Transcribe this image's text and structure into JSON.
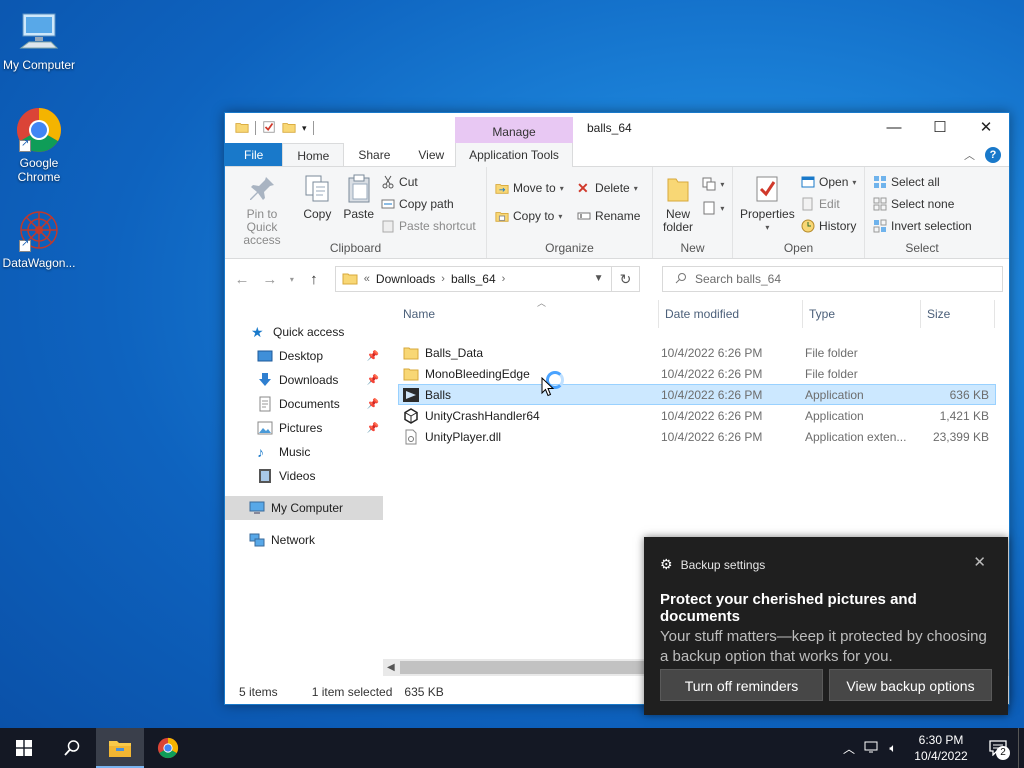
{
  "desktop": {
    "icons": [
      {
        "label": "My Computer"
      },
      {
        "label": "Google Chrome"
      },
      {
        "label": "DataWagon..."
      }
    ]
  },
  "window": {
    "title": "balls_64",
    "context_tab_group": "Manage",
    "tabs": {
      "file": "File",
      "home": "Home",
      "share": "Share",
      "view": "View",
      "app_tools": "Application Tools"
    },
    "ribbon": {
      "clipboard": {
        "label": "Clipboard",
        "pin": "Pin to Quick access",
        "copy": "Copy",
        "paste": "Paste",
        "cut": "Cut",
        "copy_path": "Copy path",
        "paste_shortcut": "Paste shortcut"
      },
      "organize": {
        "label": "Organize",
        "move_to": "Move to",
        "copy_to": "Copy to",
        "delete": "Delete",
        "rename": "Rename"
      },
      "new": {
        "label": "New",
        "new_folder": "New folder"
      },
      "open": {
        "label": "Open",
        "properties": "Properties",
        "open": "Open",
        "edit": "Edit",
        "history": "History"
      },
      "select": {
        "label": "Select",
        "select_all": "Select all",
        "select_none": "Select none",
        "invert": "Invert selection"
      }
    },
    "address": {
      "crumbs": [
        "Downloads",
        "balls_64"
      ],
      "search_placeholder": "Search balls_64"
    },
    "nav_pane": {
      "quick_access": "Quick access",
      "items": [
        "Desktop",
        "Downloads",
        "Documents",
        "Pictures",
        "Music",
        "Videos"
      ],
      "my_computer": "My Computer",
      "network": "Network"
    },
    "columns": {
      "name": "Name",
      "date": "Date modified",
      "type": "Type",
      "size": "Size"
    },
    "files": [
      {
        "name": "Balls_Data",
        "date": "10/4/2022 6:26 PM",
        "type": "File folder",
        "size": ""
      },
      {
        "name": "MonoBleedingEdge",
        "date": "10/4/2022 6:26 PM",
        "type": "File folder",
        "size": ""
      },
      {
        "name": "Balls",
        "date": "10/4/2022 6:26 PM",
        "type": "Application",
        "size": "636 KB"
      },
      {
        "name": "UnityCrashHandler64",
        "date": "10/4/2022 6:26 PM",
        "type": "Application",
        "size": "1,421 KB"
      },
      {
        "name": "UnityPlayer.dll",
        "date": "10/4/2022 6:26 PM",
        "type": "Application exten...",
        "size": "23,399 KB"
      }
    ],
    "status": {
      "count": "5 items",
      "selected": "1 item selected",
      "size": "635 KB"
    }
  },
  "toast": {
    "app": "Backup settings",
    "title": "Protect your cherished pictures and documents",
    "body": "Your stuff matters—keep it protected by choosing a backup option that works for you.",
    "btn_off": "Turn off reminders",
    "btn_view": "View backup options"
  },
  "taskbar": {
    "time": "6:30 PM",
    "date": "10/4/2022",
    "notifications": "2"
  },
  "colors": {
    "accent": "#1979ca",
    "selection": "#cce8ff",
    "manage_tab": "#e8c8f3",
    "toast_bg": "#1f1f1f"
  }
}
